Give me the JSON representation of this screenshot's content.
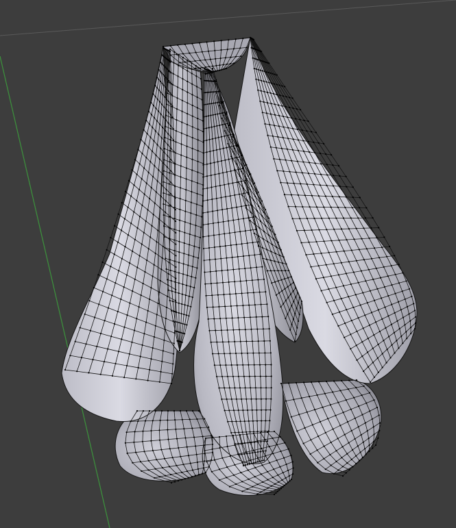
{
  "viewport": {
    "mode": "3d-viewport-edit-mode",
    "shading": "solid-wireframe",
    "object": "skirt-mesh",
    "grid_floor": true,
    "y_axis_visible": true
  },
  "colors": {
    "background": "#3d3d3d",
    "grid_line": "#5a5a5a",
    "y_axis": "#3d8f3d",
    "mesh_light": "#d8d8e0",
    "mesh_mid": "#b5b5be",
    "mesh_dark": "#85858e",
    "wire": "#141414",
    "vertex": "#000000"
  }
}
